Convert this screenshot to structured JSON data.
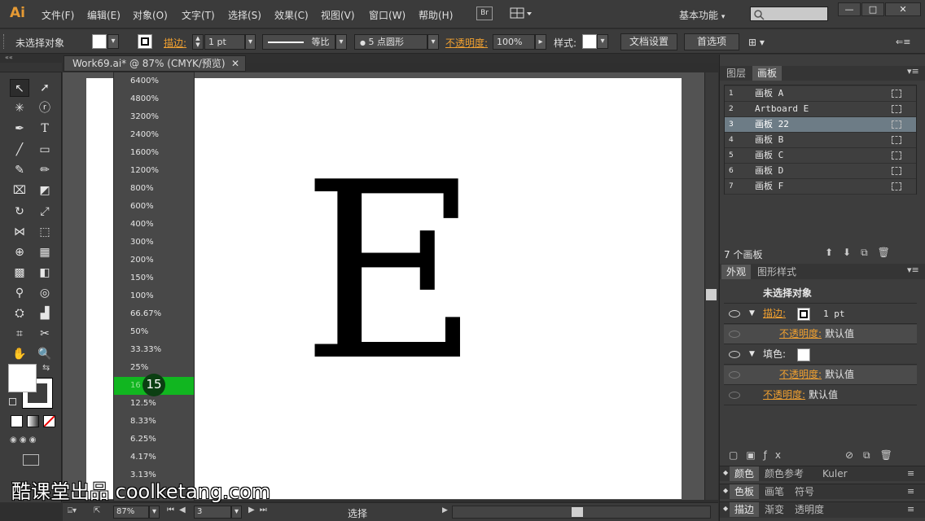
{
  "app": {
    "logo": "Ai",
    "menus": [
      "文件(F)",
      "编辑(E)",
      "对象(O)",
      "文字(T)",
      "选择(S)",
      "效果(C)",
      "视图(V)",
      "窗口(W)",
      "帮助(H)"
    ],
    "bridge": "Br",
    "workspace": "基本功能",
    "window_buttons": [
      "—",
      "□",
      "✕"
    ]
  },
  "control": {
    "selection": "未选择对象",
    "stroke_label": "描边:",
    "stroke_weight": "1 pt",
    "stroke_style": "等比",
    "brush": "5 点圆形",
    "opacity_label": "不透明度:",
    "opacity": "100%",
    "style_label": "样式:",
    "doc_setup": "文档设置",
    "prefs": "首选项"
  },
  "document": {
    "tab": "Work69.ai* @ 87% (CMYK/预览)",
    "letter": "E"
  },
  "zoom_menu": {
    "items": [
      "6400%",
      "4800%",
      "3200%",
      "2400%",
      "1600%",
      "1200%",
      "800%",
      "600%",
      "400%",
      "300%",
      "200%",
      "150%",
      "100%",
      "66.67%",
      "50%",
      "33.33%",
      "25%",
      "16.67%",
      "12.5%",
      "8.33%",
      "6.25%",
      "4.17%",
      "3.13%"
    ],
    "highlighted_index": 17,
    "highlighted_visible": "16",
    "badge": "15"
  },
  "status": {
    "zoom": "87%",
    "artboard": "3",
    "tool": "选择"
  },
  "watermark": "酷课堂出品 coolketang.com",
  "artboards_panel": {
    "tabs": [
      "图层",
      "画板"
    ],
    "rows": [
      {
        "num": "1",
        "name": "画板 A"
      },
      {
        "num": "2",
        "name": "Artboard E"
      },
      {
        "num": "3",
        "name": "画板 22"
      },
      {
        "num": "4",
        "name": "画板 B"
      },
      {
        "num": "5",
        "name": "画板 C"
      },
      {
        "num": "6",
        "name": "画板 D"
      },
      {
        "num": "7",
        "name": "画板 F"
      }
    ],
    "selected_index": 2,
    "count": "7 个画板"
  },
  "appearance": {
    "tabs": [
      "外观",
      "图形样式"
    ],
    "title": "未选择对象",
    "stroke": "描边:",
    "stroke_value": "1 pt",
    "opacity": "不透明度:",
    "default": "默认值",
    "fill": "填色:"
  },
  "bottom_panels": {
    "row1": [
      "颜色",
      "颜色参考",
      "Kuler"
    ],
    "row2": [
      "色板",
      "画笔",
      "符号"
    ],
    "row3": [
      "描边",
      "渐变",
      "透明度"
    ]
  }
}
